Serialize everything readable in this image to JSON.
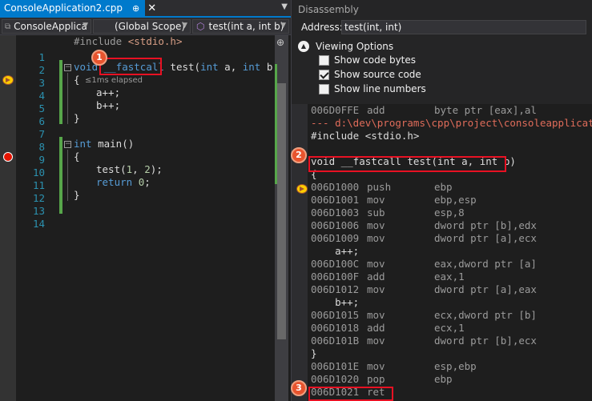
{
  "editor": {
    "tab_label": "ConsoleApplication2.cpp",
    "tab_pin": "⊕",
    "tab_close": "✕",
    "project_dropdown": "ConsoleApplica",
    "scope_dropdown": "(Global Scope)",
    "function_dropdown": "test(int a, int b)",
    "elapsed_tip": "≤1ms elapsed",
    "line_numbers": [
      "1",
      "2",
      "3",
      "4",
      "5",
      "6",
      "7",
      "8",
      "9",
      "10",
      "11",
      "12",
      "13",
      "14"
    ],
    "lines": {
      "l0_pp": "#include",
      "l0_inc": " <stdio.h>",
      "l3_kw": "void",
      "l3_fast": "__fastcall",
      "l3_rest1": " test(",
      "l3_int1": "int",
      "l3_a": " a, ",
      "l3_int2": "int",
      "l3_b": " b)",
      "l4": "{",
      "l5": "a++;",
      "l6": "b++;",
      "l7": "}",
      "l9_kw": "int",
      "l9_rest": " main()",
      "l10": "{",
      "l11_call": "test(",
      "l11_1": "1",
      "l11_sep": ", ",
      "l11_2": "2",
      "l11_end": ");",
      "l12_kw": "return",
      "l12_sp": " ",
      "l12_num": "0",
      "l12_end": ";",
      "l13": "}"
    }
  },
  "disassembly": {
    "title": "Disassembly",
    "address_label": "Address:",
    "address_value": "test(int, int)",
    "viewing_options_label": "Viewing Options",
    "options": [
      {
        "label": "Show code bytes",
        "checked": false
      },
      {
        "label": "Show source code",
        "checked": true
      },
      {
        "label": "Show line numbers",
        "checked": false
      }
    ],
    "rows": [
      {
        "addr": "006D0FFE",
        "op": "add",
        "args": "byte ptr [eax],al"
      },
      {
        "path": "--- d:\\dev\\programs\\cpp\\project\\consoleapplication"
      },
      {
        "src": "#include <stdio.h>"
      },
      {
        "src": ""
      },
      {
        "src": "void __fastcall test(int a, int b)"
      },
      {
        "src": "{"
      },
      {
        "addr": "006D1000",
        "op": "push",
        "args": "ebp"
      },
      {
        "addr": "006D1001",
        "op": "mov",
        "args": "ebp,esp"
      },
      {
        "addr": "006D1003",
        "op": "sub",
        "args": "esp,8"
      },
      {
        "addr": "006D1006",
        "op": "mov",
        "args": "dword ptr [b],edx"
      },
      {
        "addr": "006D1009",
        "op": "mov",
        "args": "dword ptr [a],ecx"
      },
      {
        "src": "    a++;"
      },
      {
        "addr": "006D100C",
        "op": "mov",
        "args": "eax,dword ptr [a]"
      },
      {
        "addr": "006D100F",
        "op": "add",
        "args": "eax,1"
      },
      {
        "addr": "006D1012",
        "op": "mov",
        "args": "dword ptr [a],eax"
      },
      {
        "src": "    b++;"
      },
      {
        "addr": "006D1015",
        "op": "mov",
        "args": "ecx,dword ptr [b]"
      },
      {
        "addr": "006D1018",
        "op": "add",
        "args": "ecx,1"
      },
      {
        "addr": "006D101B",
        "op": "mov",
        "args": "dword ptr [b],ecx"
      },
      {
        "src": "}"
      },
      {
        "addr": "006D101E",
        "op": "mov",
        "args": "esp,ebp"
      },
      {
        "addr": "006D1020",
        "op": "pop",
        "args": "ebp"
      },
      {
        "addr": "006D1021",
        "op": "ret",
        "args": ""
      }
    ]
  },
  "callouts": [
    "1",
    "2",
    "3"
  ]
}
